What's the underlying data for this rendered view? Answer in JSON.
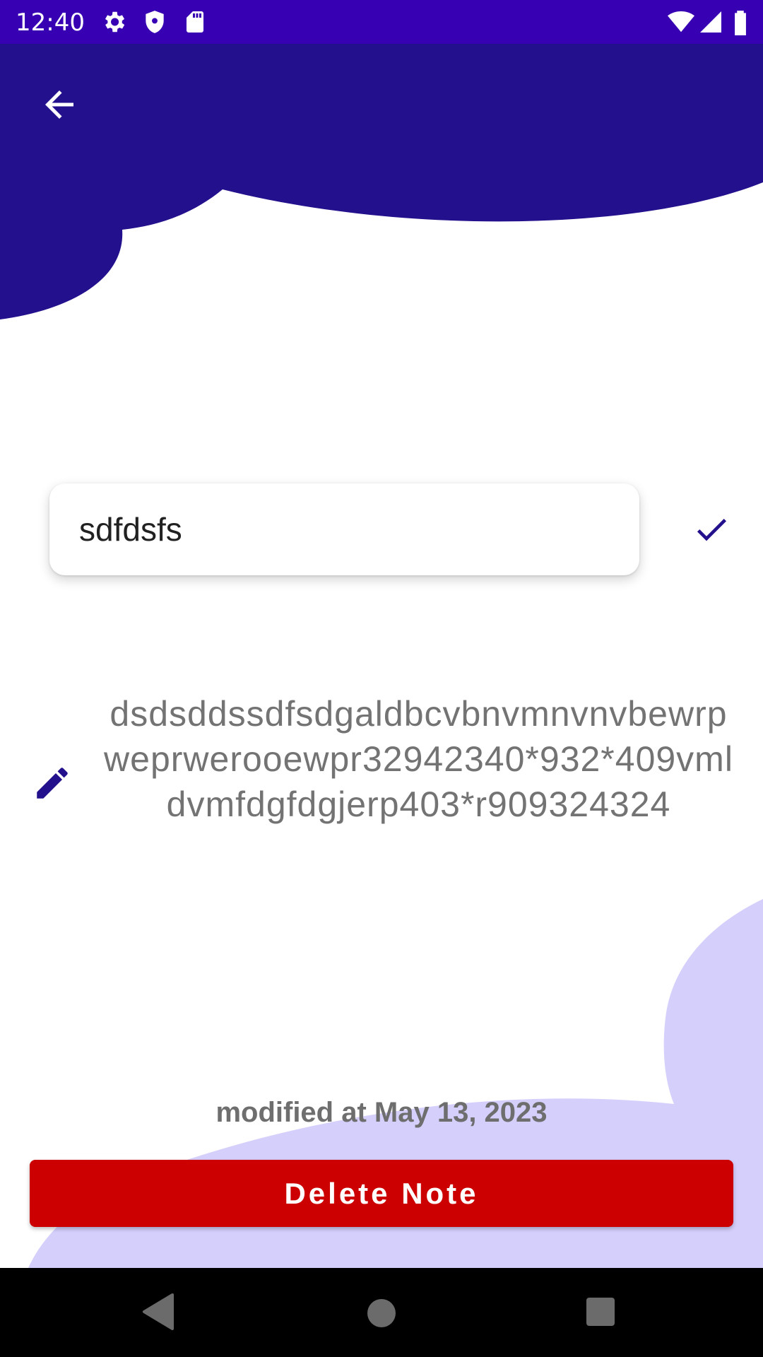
{
  "status_bar": {
    "time": "12:40",
    "icons": [
      "settings-icon",
      "shield-icon",
      "sd-card-icon",
      "wifi-icon",
      "signal-icon",
      "battery-icon"
    ]
  },
  "header": {
    "back_icon": "arrow-back-icon"
  },
  "note": {
    "title_value": "sdfdsfs",
    "body": "dsdsddssdfsdgaldbcvbnvmnvnvbewrpweprwerooewpr32942340*932*409vmldvmfdgfdgjerp403*r909324324",
    "modified_text": "modified at May 13, 2023"
  },
  "actions": {
    "delete_label": "Delete Note",
    "confirm_icon": "check-icon",
    "edit_icon": "pencil-icon"
  },
  "colors": {
    "status_bar": "#3700b3",
    "header_blob": "#22108c",
    "accent_blob": "#d5cffc",
    "delete_button": "#cc0000",
    "icon_accent": "#22108c"
  },
  "nav_bar": {
    "icons": [
      "back-triangle-icon",
      "home-circle-icon",
      "recents-square-icon"
    ]
  }
}
